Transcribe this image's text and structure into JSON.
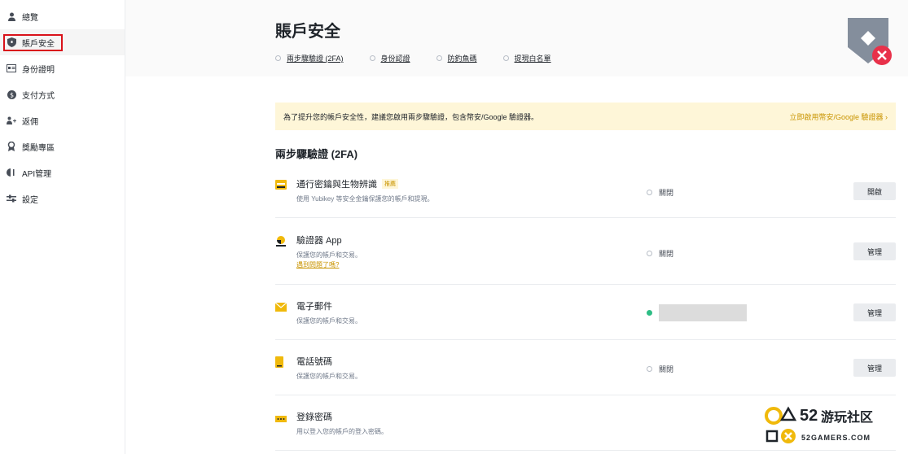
{
  "sidebar": {
    "items": [
      {
        "label": "總覽",
        "icon": "user-icon",
        "active": false
      },
      {
        "label": "賬戶安全",
        "icon": "shield-icon",
        "active": true
      },
      {
        "label": "身份證明",
        "icon": "id-card-icon",
        "active": false
      },
      {
        "label": "支付方式",
        "icon": "dollar-icon",
        "active": false
      },
      {
        "label": "返佣",
        "icon": "add-user-icon",
        "active": false
      },
      {
        "label": "獎勵專區",
        "icon": "award-icon",
        "active": false
      },
      {
        "label": "API管理",
        "icon": "api-icon",
        "active": false
      },
      {
        "label": "設定",
        "icon": "sliders-icon",
        "active": false
      }
    ]
  },
  "header": {
    "title": "賬戶安全",
    "tabs": [
      "兩步驟驗證 (2FA)",
      "身份認證",
      "防釣魚碼",
      "提現白名單"
    ],
    "badge_icon": "security-shield-warning-icon"
  },
  "banner": {
    "text": "為了提升您的帳戶安全性，建議您啟用兩步驟驗證，包含幣安/Google 驗證器。",
    "link": "立即啟用幣安/Google 驗證器 ›"
  },
  "section_title": "兩步驟驗證 (2FA)",
  "rows": [
    {
      "title": "通行密鑰與生物辨識",
      "tag": "推薦",
      "desc": "使用 Yubikey 等安全金鑰保護您的帳戶和提現。",
      "link": "",
      "status": "關閉",
      "enabled": false,
      "button": "開啟",
      "icon": "passkey-icon"
    },
    {
      "title": "驗證器 App",
      "tag": "",
      "desc": "保護您的帳戶和交易。",
      "link": "遇到問題了嗎?",
      "status": "關閉",
      "enabled": false,
      "button": "管理",
      "icon": "authenticator-icon"
    },
    {
      "title": "電子郵件",
      "tag": "",
      "desc": "保護您的帳戶和交易。",
      "link": "",
      "status": "",
      "enabled": true,
      "button": "管理",
      "icon": "email-icon"
    },
    {
      "title": "電話號碼",
      "tag": "",
      "desc": "保護您的帳戶和交易。",
      "link": "",
      "status": "關閉",
      "enabled": false,
      "button": "管理",
      "icon": "phone-icon"
    },
    {
      "title": "登錄密碼",
      "tag": "",
      "desc": "用以登入您的帳戶的登入密碼。",
      "link": "",
      "status": "",
      "enabled": false,
      "button": "",
      "icon": "password-icon"
    }
  ],
  "watermark": {
    "number": "52",
    "cn": "游玩社区",
    "en": "52GAMERS.COM"
  },
  "colors": {
    "accent": "#f0b90b",
    "highlight_border": "#d9121a",
    "banner_bg": "#fef6d8",
    "link": "#c99400",
    "success": "#2ebd85"
  }
}
